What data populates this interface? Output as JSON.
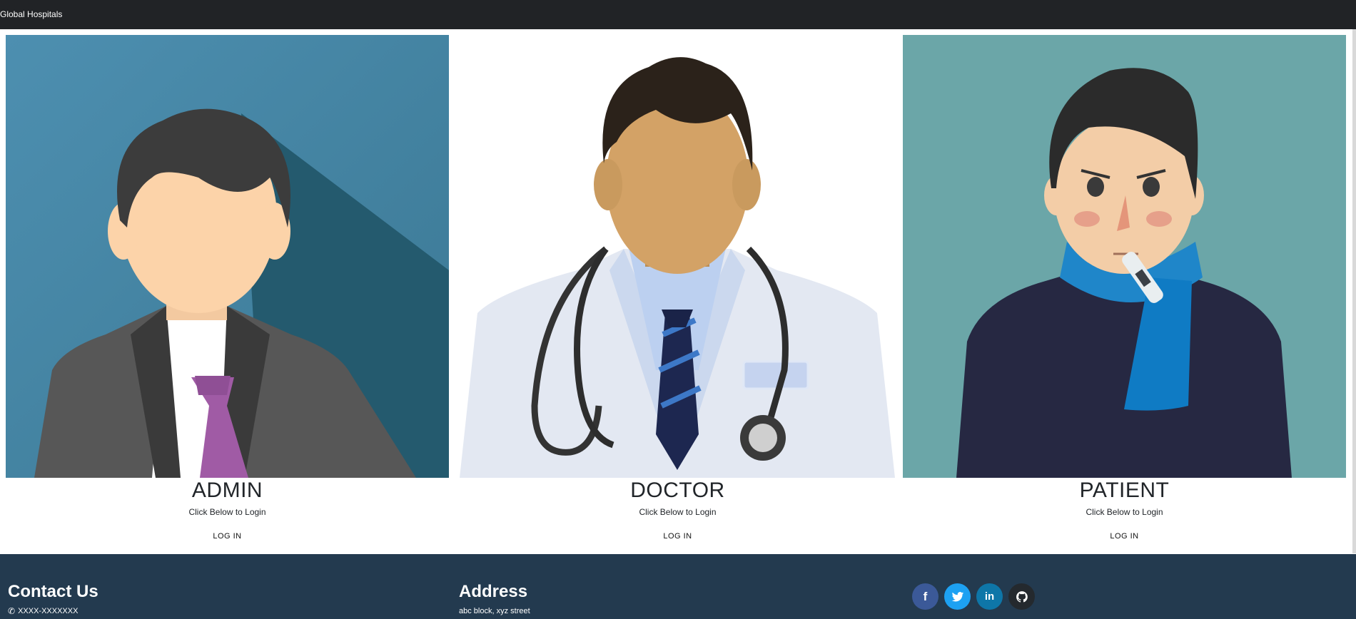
{
  "navbar": {
    "brand": "Global Hospitals"
  },
  "cards": [
    {
      "title": "ADMIN",
      "subtitle": "Click Below to Login",
      "login_label": "LOG IN"
    },
    {
      "title": "DOCTOR",
      "subtitle": "Click Below to Login",
      "login_label": "LOG IN"
    },
    {
      "title": "PATIENT",
      "subtitle": "Click Below to Login",
      "login_label": "LOG IN"
    }
  ],
  "footer": {
    "contact": {
      "heading": "Contact Us",
      "phone": "XXXX-XXXXXXX",
      "phone_icon": "phone-icon"
    },
    "address": {
      "heading": "Address",
      "line": "abc block, xyz street"
    },
    "social": [
      {
        "name": "facebook",
        "icon": "facebook-icon",
        "color": "#3b5998"
      },
      {
        "name": "twitter",
        "icon": "twitter-icon",
        "color": "#1da1f2"
      },
      {
        "name": "linkedin",
        "icon": "linkedin-icon",
        "color": "#0e76a8"
      },
      {
        "name": "github",
        "icon": "github-icon",
        "color": "#24292e"
      }
    ]
  },
  "colors": {
    "navbar_bg": "#212326",
    "footer_bg": "#233a4f",
    "admin_bg": "#4a8aab",
    "patient_bg": "#6ba6a8"
  }
}
